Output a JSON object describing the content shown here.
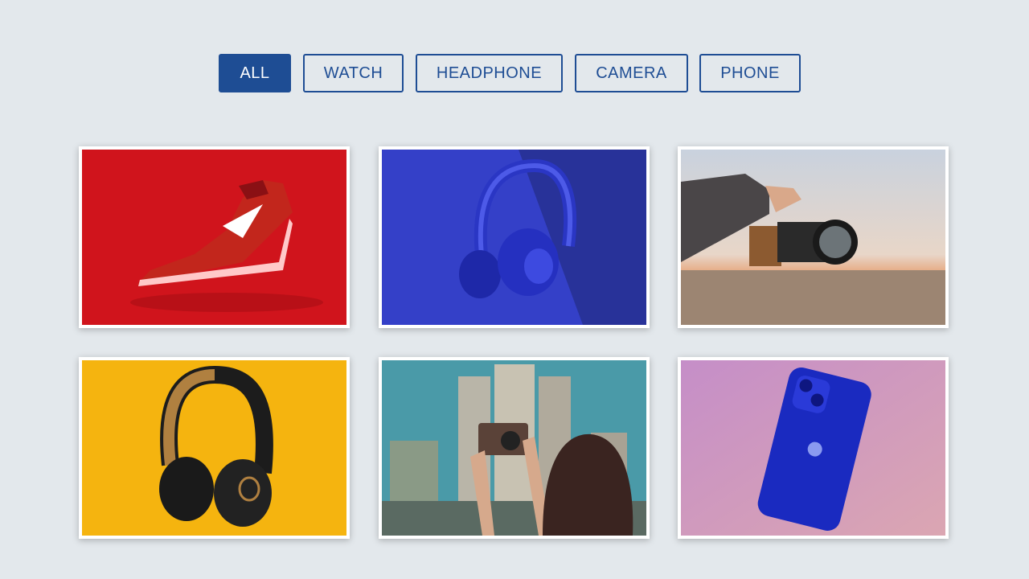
{
  "filters": {
    "all": "ALL",
    "watch": "WATCH",
    "headphone": "HEADPHONE",
    "camera": "CAMERA",
    "phone": "PHONE",
    "active": "ALL"
  },
  "colors": {
    "accent": "#1e4d94",
    "page_background": "#e3e8ec",
    "card_border": "#ffffff"
  },
  "gallery": {
    "items": [
      {
        "category": "watch",
        "subject": "sneaker-image",
        "background": "#d0141c"
      },
      {
        "category": "headphone",
        "subject": "headphone-image",
        "background": "#3440c8"
      },
      {
        "category": "camera",
        "subject": "camera-hand-image",
        "background": "#c9cfd8"
      },
      {
        "category": "headphone",
        "subject": "headphone-image",
        "background": "#f5b40f"
      },
      {
        "category": "camera",
        "subject": "camera-hand-image",
        "background": "#4a9aa8"
      },
      {
        "category": "phone",
        "subject": "phone-image",
        "background": "#c58ec8"
      }
    ]
  }
}
